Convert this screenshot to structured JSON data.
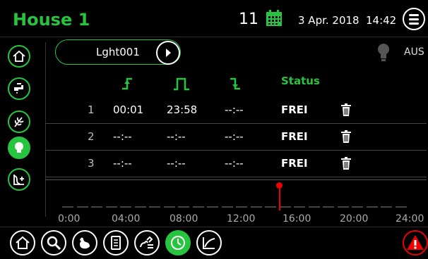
{
  "header": {
    "title": "House 1",
    "day": "11",
    "date": "3 Apr. 2018",
    "time": "14:42"
  },
  "sidebar": {
    "items": [
      "home-icon",
      "water-tap-icon",
      "feed-icon",
      "light-bulb-icon",
      "curve-add-icon"
    ],
    "active": "light-bulb-icon"
  },
  "device": {
    "name": "Lght001",
    "state": "AUS"
  },
  "table": {
    "status_header": "Status",
    "column_icons": [
      "rising-edge-icon",
      "pulse-icon",
      "falling-edge-icon"
    ],
    "rows": [
      {
        "num": "1",
        "c1": "00:01",
        "c2": "23:58",
        "c3": "--:--",
        "status": "FREI"
      },
      {
        "num": "2",
        "c1": "--:--",
        "c2": "--:--",
        "c3": "--:--",
        "status": "FREI"
      },
      {
        "num": "3",
        "c1": "--:--",
        "c2": "--:--",
        "c3": "--:--",
        "status": "FREI"
      }
    ]
  },
  "timeline": {
    "labels": [
      "0:00",
      "04:00",
      "08:00",
      "12:00",
      "16:00",
      "20:00",
      "24:00"
    ],
    "current_hour": 14.7
  },
  "bottom_nav": {
    "items": [
      "home-icon",
      "search-icon",
      "chicken-icon",
      "document-icon",
      "feed-animal-icon",
      "clock-icon",
      "chart-icon",
      "alarm-icon"
    ],
    "active": "clock-icon"
  },
  "colors": {
    "accent": "#27c43f",
    "alarm": "#e00000"
  }
}
